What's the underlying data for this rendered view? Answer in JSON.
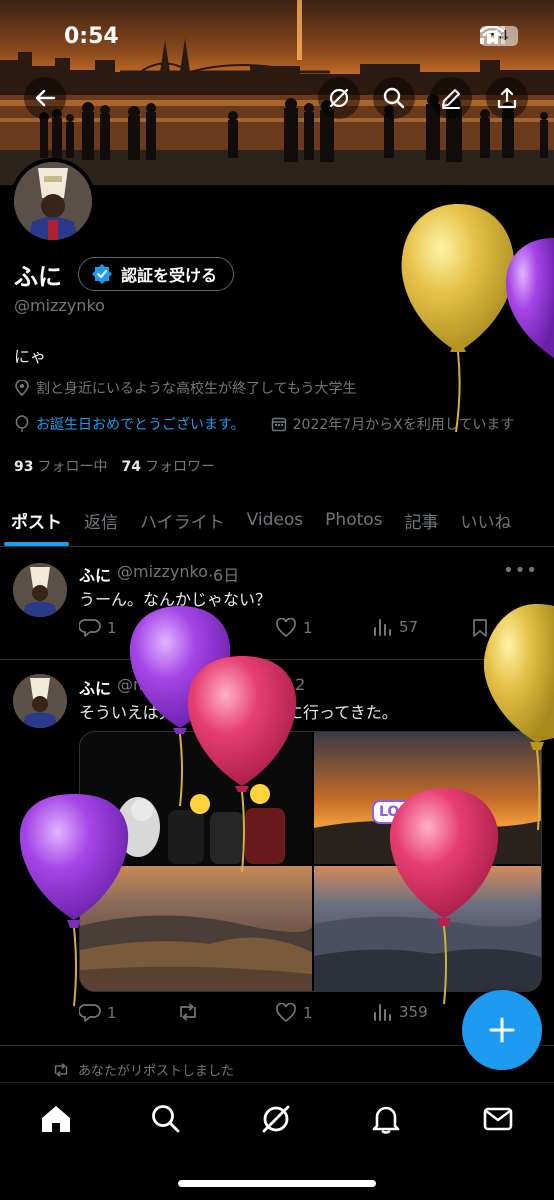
{
  "status_bar": {
    "time": "0:54",
    "battery": "54"
  },
  "header": {
    "back_icon": "arrow-left-icon",
    "grok_icon": "grok-icon",
    "search_icon": "search-icon",
    "edit_icon": "pencil-icon",
    "share_icon": "share-icon"
  },
  "profile": {
    "name": "ふに",
    "verify_label": "認証を受ける",
    "handle": "@mizzynko",
    "bio": "にゃ",
    "location": "割と身近にいるような高校生が終了してもう大学生",
    "birthday": "お誕生日おめでとうございます。",
    "joined": "2022年7月からXを利用しています",
    "following_count": "93",
    "following_label": "フォロー中",
    "followers_count": "74",
    "followers_label": "フォロワー"
  },
  "tabs": [
    {
      "label": "ポスト",
      "active": true
    },
    {
      "label": "返信"
    },
    {
      "label": "ハイライト"
    },
    {
      "label": "Videos"
    },
    {
      "label": "Photos"
    },
    {
      "label": "記事"
    },
    {
      "label": "いいね"
    }
  ],
  "posts": [
    {
      "name": "ふに",
      "handle": "@mizzynko",
      "time": "·6日",
      "text": "うーん。なんかじゃない？",
      "replies": "1",
      "likes": "1",
      "views": "57"
    },
    {
      "name": "ふに",
      "handle": "@mizzynko",
      "time": "·2025/11/12",
      "text": "そういえば先週末に霧降高原に行ってきた。",
      "replies": "1",
      "likes": "1",
      "views": "359"
    }
  ],
  "repost_note": "あなたがリポストしました",
  "stickers": {
    "lol1": "LOL",
    "lol2": "LOL"
  },
  "colors": {
    "accent": "#1d9bf0",
    "background": "#000000",
    "muted": "#71767b"
  },
  "nav": [
    "home-icon",
    "search-icon",
    "grok-icon",
    "bell-icon",
    "mail-icon"
  ]
}
